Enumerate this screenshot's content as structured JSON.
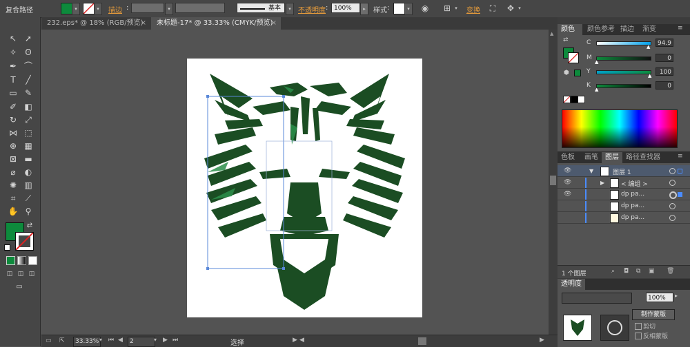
{
  "control_bar": {
    "object_type": "复合路径",
    "stroke_label": "描边",
    "stroke_style": "基本",
    "opacity_label": "不透明度",
    "opacity_value": "100%",
    "style_label": "样式",
    "transform_label": "变换"
  },
  "colors": {
    "fill": "#0d8a3c",
    "wolf": "#1b4d23",
    "selection": "#5a88d8",
    "highlight": "#2b8f4a"
  },
  "tabs": [
    {
      "label": "232.eps* @ 18% (RGB/预览)",
      "close": "×"
    },
    {
      "label": "未标题-17* @ 33.33% (CMYK/预览)",
      "close": "×"
    }
  ],
  "color_panel": {
    "tabs": [
      "颜色",
      "颜色参考",
      "描边",
      "渐变"
    ],
    "channels": [
      {
        "label": "C",
        "value": "94.9",
        "fraction": 0.949
      },
      {
        "label": "M",
        "value": "0",
        "fraction": 0
      },
      {
        "label": "Y",
        "value": "100",
        "fraction": 1
      },
      {
        "label": "K",
        "value": "0",
        "fraction": 0
      }
    ]
  },
  "layers_panel": {
    "tabs": [
      "色板",
      "画笔",
      "图层",
      "路径查找器"
    ],
    "rows": [
      {
        "name": "图层 1",
        "expander": "▼"
      },
      {
        "name": "< 编组 >",
        "expander": "▶"
      },
      {
        "name": "dp pa..."
      },
      {
        "name": "dp pa..."
      },
      {
        "name": "dp pa..."
      }
    ],
    "footer": "1 个图层"
  },
  "transparency_panel": {
    "title": "透明度",
    "opacity": "100%",
    "make_mask": "制作蒙版",
    "clip": "剪切",
    "invert_mask": "反相蒙版"
  },
  "status_bar": {
    "zoom": "33.33%",
    "page": "2",
    "tool": "选择"
  }
}
